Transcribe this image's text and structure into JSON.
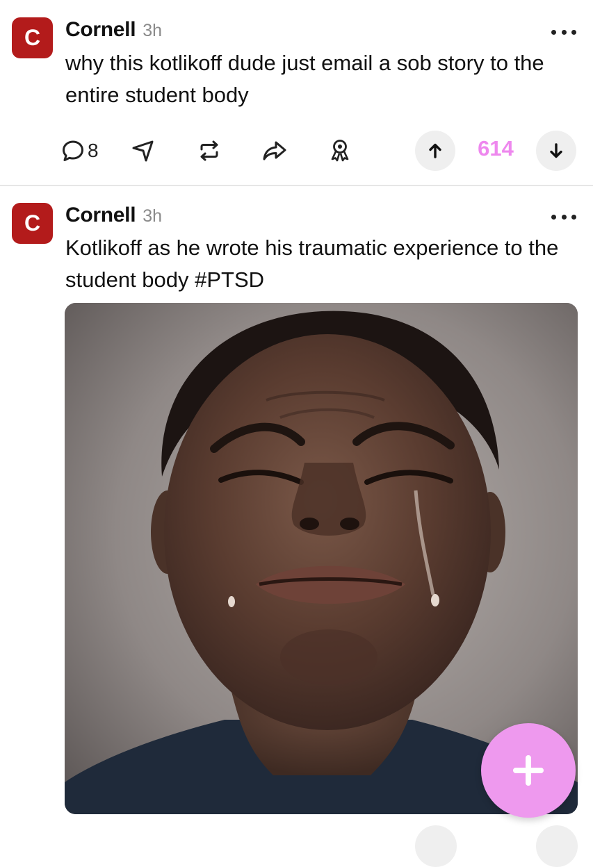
{
  "posts": [
    {
      "avatar_letter": "C",
      "author": "Cornell",
      "time": "3h",
      "text": "why this kotlikoff dude just email a sob story to the entire student body",
      "comment_count": "8",
      "score": "614"
    },
    {
      "avatar_letter": "C",
      "author": "Cornell",
      "time": "3h",
      "text": "Kotlikoff as he wrote his traumatic experience to the student body #PTSD"
    }
  ],
  "icons": {
    "more": "more-dots-icon",
    "comment": "comment-icon",
    "send": "send-icon",
    "repost": "repost-icon",
    "share": "share-icon",
    "award": "award-icon",
    "upvote": "upvote-arrow-icon",
    "downvote": "downvote-arrow-icon",
    "compose": "plus-icon"
  },
  "colors": {
    "avatar": "#b31b1b",
    "score": "#ee88ee",
    "fab": "#ee99ee",
    "vote_button_bg": "#efefef"
  }
}
